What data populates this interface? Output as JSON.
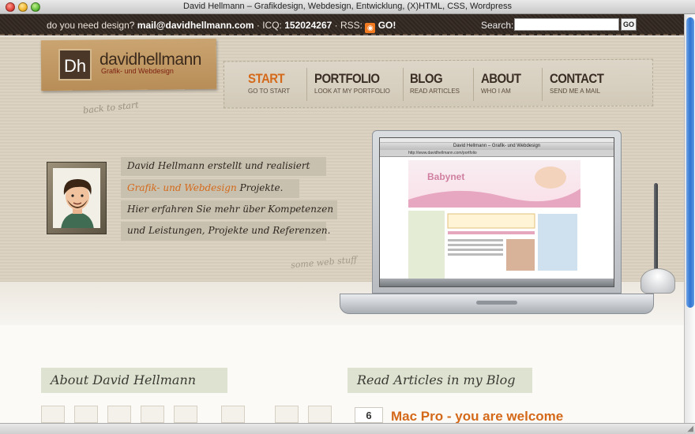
{
  "window": {
    "title": "David Hellmann – Grafikdesign, Webdesign, Entwicklung, (X)HTML, CSS, Wordpress"
  },
  "topbar": {
    "prompt": "do you need design?",
    "email": "mail@davidhellmann.com",
    "icq_label": "ICQ:",
    "icq_number": "152024267",
    "rss_label": "RSS:",
    "rss_go": "GO!",
    "search_label": "Search:",
    "search_value": "",
    "search_button": "GO"
  },
  "logo": {
    "mark": "Dh",
    "name": "davidhellmann",
    "tagline": "Grafik- und Webdesign",
    "back_to_start": "back to start"
  },
  "nav": [
    {
      "label": "START",
      "sub": "GO TO START",
      "active": true
    },
    {
      "label": "PORTFOLIO",
      "sub": "LOOK AT MY PORTFOLIO",
      "active": false
    },
    {
      "label": "BLOG",
      "sub": "READ ARTICLES",
      "active": false
    },
    {
      "label": "ABOUT",
      "sub": "WHO I AM",
      "active": false
    },
    {
      "label": "CONTACT",
      "sub": "SEND ME A MAIL",
      "active": false
    }
  ],
  "intro": {
    "line1": "David Hellmann erstellt und realisiert",
    "line2_accent": "Grafik- und Webdesign",
    "line2_rest": " Projekte.",
    "line3": "Hier erfahren Sie mehr über Kompetenzen",
    "line4": "und Leistungen, Projekte und Referenzen.",
    "more": "some web stuff"
  },
  "laptop_screen": {
    "window_title": "David Hellmann – Grafik- und Webdesign",
    "address": "http://www.davidhellmann.com/portfolio",
    "site_logo": "Babynet"
  },
  "about": {
    "heading": "About David Hellmann"
  },
  "blog": {
    "heading": "Read Articles in my Blog",
    "date_day": "6",
    "post_title": "Mac Pro - you are welcome"
  },
  "colors": {
    "accent": "#d4691a",
    "topbar": "#2f2620",
    "paper": "#dcd3c2"
  }
}
